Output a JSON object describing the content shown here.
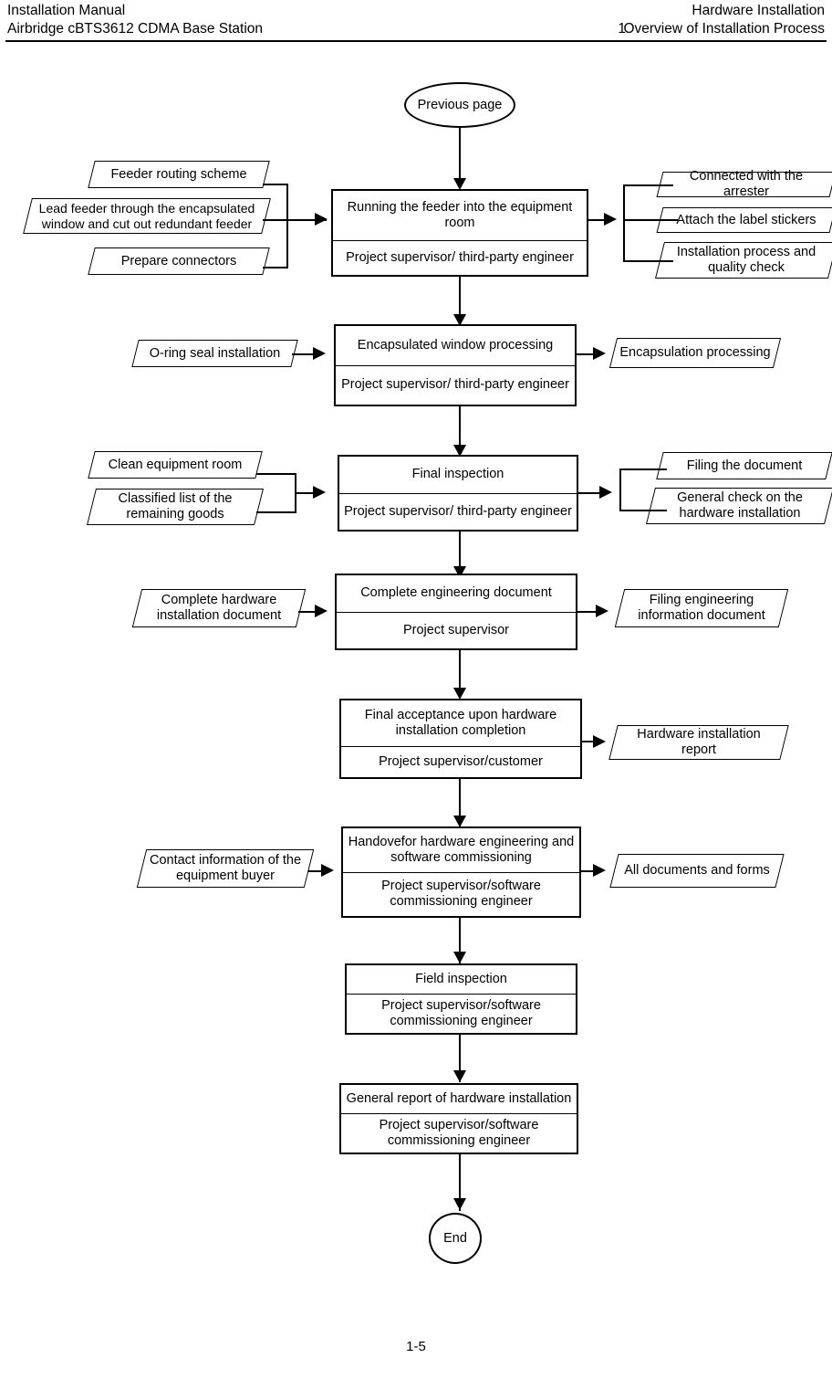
{
  "header": {
    "left_line1": "Installation Manual",
    "left_line2": "Airbridge cBTS3612 CDMA Base Station",
    "right_line1": "Hardware Installation",
    "chapter_number": "1",
    "right_line2": "Overview of Installation Process"
  },
  "footer": {
    "page_number": "1-5"
  },
  "flow": {
    "start": {
      "label": "Previous page"
    },
    "end": {
      "label": "End"
    },
    "steps": [
      {
        "id": "running-feeder",
        "title": "Running the feeder into the equipment room",
        "role": "Project supervisor/ third-party engineer",
        "inputs": [
          "Feeder routing scheme",
          "Lead feeder through the encapsulated\nwindow and cut out redundant feeder",
          "Prepare connectors"
        ],
        "outputs": [
          "Connected with the arrester",
          "Attach the label stickers",
          "Installation process and\nquality check"
        ]
      },
      {
        "id": "encapsulated-window",
        "title": "Encapsulated window processing",
        "role": "Project supervisor/ third-party engineer",
        "inputs": [
          "O-ring seal installation"
        ],
        "outputs": [
          "Encapsulation processing"
        ]
      },
      {
        "id": "final-inspection",
        "title": "Final inspection",
        "role": "Project supervisor/ third-party engineer",
        "inputs": [
          "Clean equipment room",
          "Classified list of  the\nremaining goods"
        ],
        "outputs": [
          "Filing the document",
          "General check on the\nhardware installation"
        ]
      },
      {
        "id": "complete-engineering-document",
        "title": "Complete engineering document",
        "role": "Project supervisor",
        "inputs": [
          "Complete hardware\ninstallation document"
        ],
        "outputs": [
          "Filing engineering\ninformation document"
        ]
      },
      {
        "id": "final-acceptance",
        "title": "Final acceptance upon hardware\ninstallation completion",
        "role": "Project supervisor/customer",
        "inputs": [],
        "outputs": [
          "Hardware installation report"
        ]
      },
      {
        "id": "handover",
        "title": "Handovefor hardware engineering and\nsoftware commissioning",
        "role": "Project supervisor/software\ncommissioning engineer",
        "inputs": [
          "Contact information of the\nequipment buyer"
        ],
        "outputs": [
          "All documents and forms"
        ]
      },
      {
        "id": "field-inspection",
        "title": "Field inspection",
        "role": "Project supervisor/software\ncommissioning engineer",
        "inputs": [],
        "outputs": []
      },
      {
        "id": "general-report",
        "title": "General report of hardware installation",
        "role": "Project supervisor/software\ncommissioning engineer",
        "inputs": [],
        "outputs": []
      }
    ]
  }
}
